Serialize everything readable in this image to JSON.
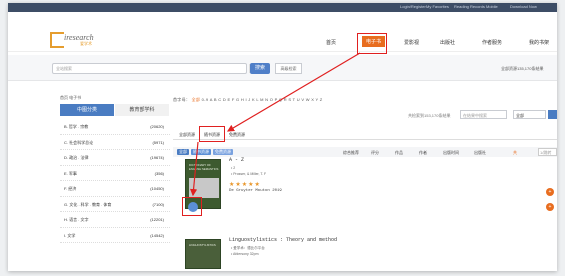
{
  "topbar": {
    "links": [
      "Login/Register",
      "My Favorites",
      "Reading Records",
      "Mobile",
      "Download Now"
    ]
  },
  "header": {
    "logo_text": "iresearch",
    "logo_sub": "爱学术",
    "nav": [
      "首页",
      "电子书",
      "爱影视",
      "出版社",
      "作者服务",
      "我的书架"
    ]
  },
  "search": {
    "placeholder": "全站搜索",
    "scope": "全部",
    "button": "搜索",
    "advanced": "高级检索",
    "total": "全部资源135,170条结果"
  },
  "sidebar": {
    "breadcrumb": "首页 电子书",
    "tab_cn": "中图分类",
    "tab_edu": "教育部学科",
    "categories": [
      {
        "name": "B. 哲学 . 宗教",
        "count": "(20620)"
      },
      {
        "name": "C. 社会科学总论",
        "count": "(5971)"
      },
      {
        "name": "D. 政治 . 法律",
        "count": "(19674)"
      },
      {
        "name": "E. 军事",
        "count": "(356)"
      },
      {
        "name": "F. 经济",
        "count": "(10450)"
      },
      {
        "name": "G. 文化 . 科学 . 教育 . 体育",
        "count": "(7100)"
      },
      {
        "name": "H. 语言 . 文字",
        "count": "(12201)"
      },
      {
        "name": "I. 文学",
        "count": "(14542)"
      }
    ]
  },
  "results": {
    "letters_label": "首字母：",
    "letters_all": "全部",
    "letters": "0-9 A B C D E F G H I J K L M N O P Q R S T U V W X Y Z",
    "found": "共检索到153,170条结果",
    "in_placeholder": "在结果中搜索",
    "in_scope": "全部",
    "tabs": [
      "全部资源",
      "随书资源",
      "免费资源"
    ],
    "tags": [
      "全部",
      "随书资源",
      "免费资源"
    ],
    "sorts": [
      "综合推荐",
      "评分",
      "作品",
      "作者",
      "出版时间",
      "出版社"
    ],
    "page_label": "共",
    "page_input": "1/跳转",
    "book1": {
      "title": "A - Z",
      "cover_title": "DICTIONARY OF ENGLISH SEMANTICS",
      "meta1": "• 2",
      "meta2": "• Prosser, & Miller, T. F",
      "stars": "★★★★★",
      "publisher": "De Gruyter Mouton 2019"
    },
    "book2": {
      "title": "Linguostylistics : Theory and method",
      "cover_title": "LINGUOSTYLISTICS",
      "meta1": "• 爱学术：德比尔平台",
      "meta2": "• Afdersony 32pm"
    },
    "side_badges": [
      "+",
      "+"
    ]
  }
}
